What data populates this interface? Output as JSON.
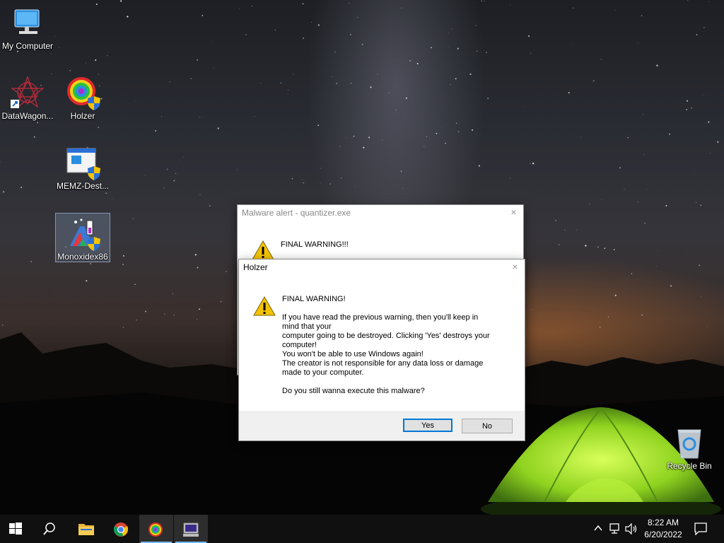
{
  "desktop": {
    "icons": [
      {
        "label": "My Computer",
        "icon": "computer-icon"
      },
      {
        "label": "DataWagon...",
        "icon": "datawagon-icon"
      },
      {
        "label": "Holzer",
        "icon": "holzer-icon"
      },
      {
        "label": "MEMZ-Dest...",
        "icon": "memz-icon"
      },
      {
        "label": "Monoxidex86",
        "icon": "monoxidex-icon",
        "selected": true
      },
      {
        "label": "Recycle Bin",
        "icon": "recycle-bin-icon"
      }
    ]
  },
  "back_dialog": {
    "title": "Malware alert - quantizer.exe",
    "heading": "FINAL WARNING!!!"
  },
  "front_dialog": {
    "title": "Holzer",
    "heading": "FINAL WARNING!",
    "lines": [
      "If you have read the previous warning, then you'll keep in",
      "mind that your",
      "computer going to be destroyed. Clicking 'Yes' destroys your",
      "computer!",
      "You won't be able to use Windows again!",
      "The creator is not responsible for any data loss or damage",
      "made to your computer."
    ],
    "question": "Do you still wanna execute this malware?",
    "yes_label": "Yes",
    "no_label": "No"
  },
  "taskbar": {
    "items": [
      "start-icon",
      "search-icon",
      "file-explorer-icon",
      "chrome-icon",
      "holzer-icon",
      "monitor-app-icon"
    ],
    "active_item": "holzer-icon",
    "clock_time": "8:22 AM",
    "clock_date": "6/20/2022"
  },
  "colors": {
    "accent": "#0078d7",
    "taskbar": "#101010",
    "warning_yellow": "#f4c300"
  }
}
